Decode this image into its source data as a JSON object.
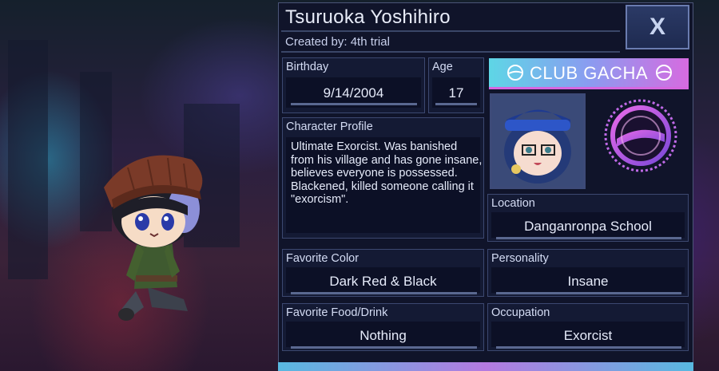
{
  "character": {
    "name": "Tsuruoka Yoshihiro",
    "created_by_label": "Created by:",
    "created_by": "4th trial"
  },
  "close_button": {
    "label": "X"
  },
  "fields": {
    "birthday": {
      "label": "Birthday",
      "value": "9/14/2004"
    },
    "age": {
      "label": "Age",
      "value": "17"
    },
    "profile": {
      "label": "Character Profile",
      "value": "Ultimate Exorcist. Was banished from his village and has gone insane, believes everyone is possessed. Blackened, killed someone calling it \"exorcism\"."
    },
    "location": {
      "label": "Location",
      "value": "Danganronpa School"
    },
    "favorite_color": {
      "label": "Favorite Color",
      "value": "Dark Red & Black"
    },
    "personality": {
      "label": "Personality",
      "value": "Insane"
    },
    "favorite_food": {
      "label": "Favorite Food/Drink",
      "value": "Nothing"
    },
    "occupation": {
      "label": "Occupation",
      "value": "Exorcist"
    }
  },
  "branding": {
    "club_label": "CLUB GACHA"
  },
  "colors": {
    "panel": "#10142a",
    "border": "#3c4870",
    "accent_cyan": "#5ed6e6",
    "accent_pink": "#d66be0"
  }
}
